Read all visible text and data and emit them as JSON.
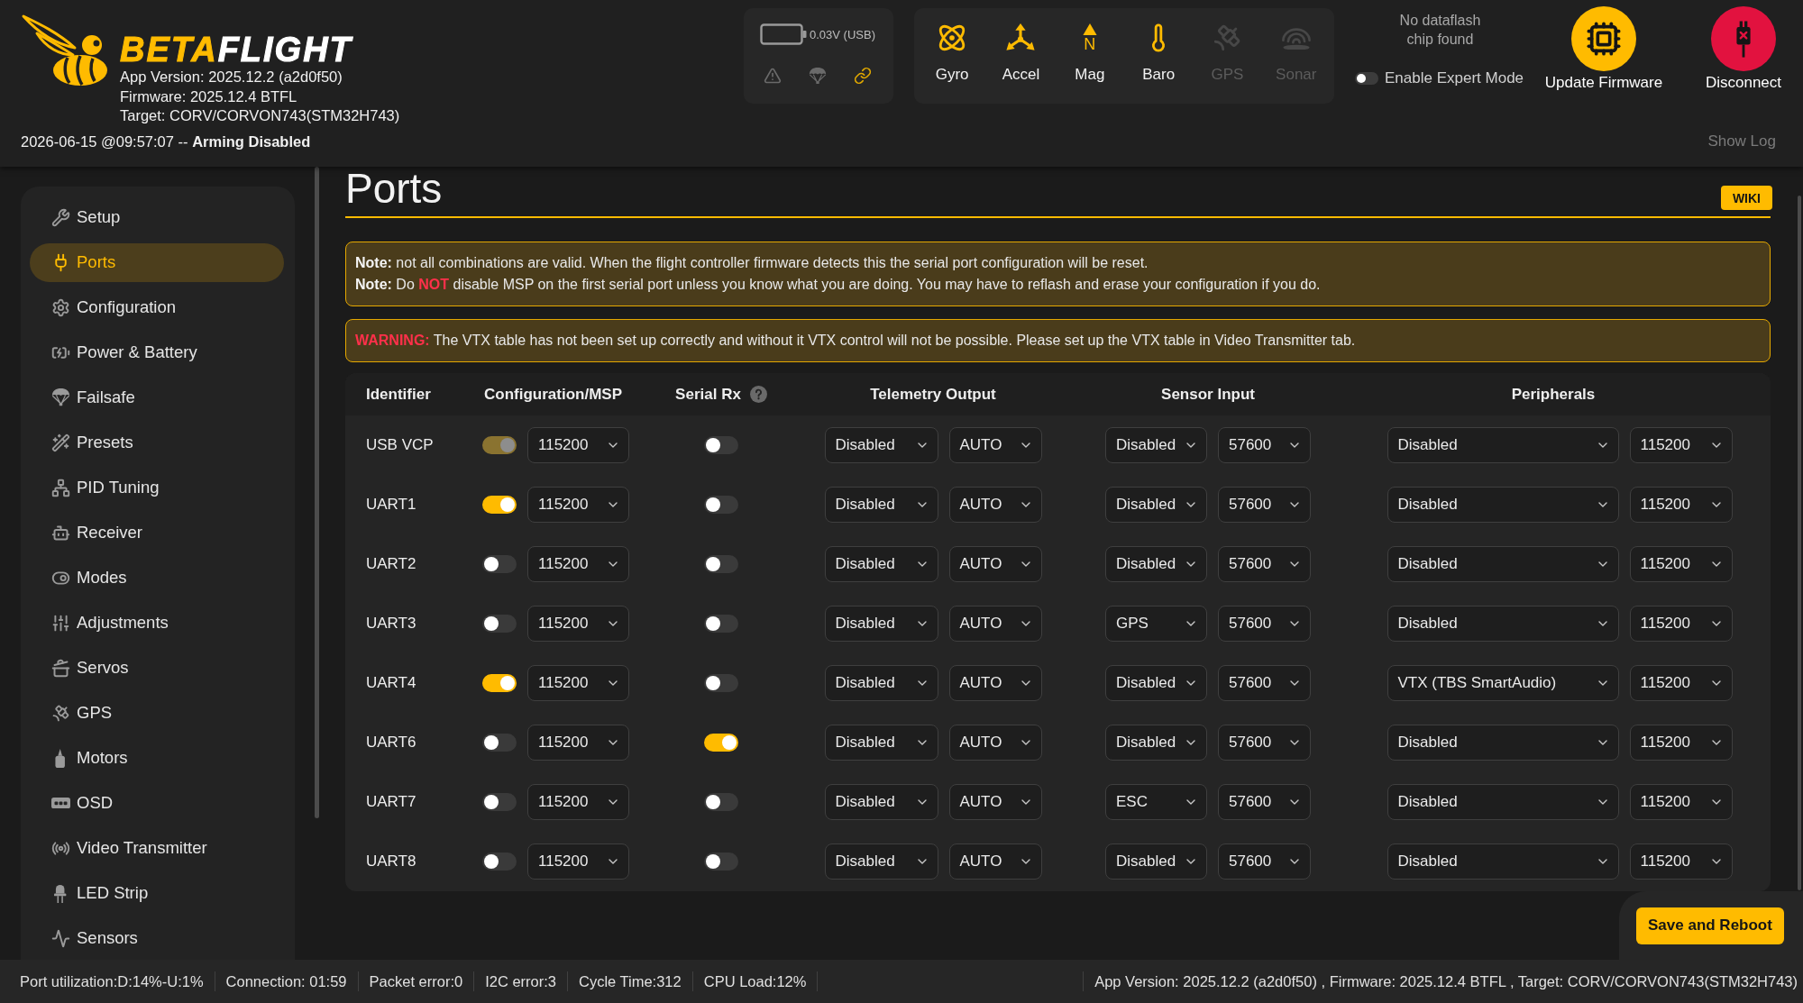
{
  "header": {
    "logo": {
      "accent": "BETA",
      "rest": "FLIGHT"
    },
    "version_lines": [
      "App Version: 2025.12.2 (a2d0f50)",
      "Firmware: 2025.12.4 BTFL",
      "Target: CORV/CORVON743(STM32H743)"
    ],
    "status_line": "2026-06-15 @09:57:07 -- **Arming Disabled**",
    "battery": {
      "reading": "0.03V (USB)"
    },
    "status_icons": [
      {
        "active": false
      },
      {
        "active": false
      },
      {
        "active": true
      }
    ],
    "sensors": [
      {
        "label": "Gyro",
        "active": true
      },
      {
        "label": "Accel",
        "active": true
      },
      {
        "label": "Mag",
        "active": true,
        "glyph": "N"
      },
      {
        "label": "Baro",
        "active": true
      },
      {
        "label": "GPS",
        "active": false
      },
      {
        "label": "Sonar",
        "active": false
      }
    ],
    "dataflash": "No dataflash chip found",
    "expert_mode": {
      "label": "Enable Expert Mode",
      "on": false
    },
    "actions": [
      {
        "kind": "update",
        "label": "Update Firmware"
      },
      {
        "kind": "disconnect",
        "label": "Disconnect"
      }
    ],
    "show_log": "Show Log"
  },
  "sidebar": {
    "items": [
      {
        "label": "Setup",
        "selected": false
      },
      {
        "label": "Ports",
        "selected": true
      },
      {
        "label": "Configuration",
        "selected": false
      },
      {
        "label": "Power & Battery",
        "selected": false
      },
      {
        "label": "Failsafe",
        "selected": false
      },
      {
        "label": "Presets",
        "selected": false
      },
      {
        "label": "PID Tuning",
        "selected": false
      },
      {
        "label": "Receiver",
        "selected": false
      },
      {
        "label": "Modes",
        "selected": false
      },
      {
        "label": "Adjustments",
        "selected": false
      },
      {
        "label": "Servos",
        "selected": false
      },
      {
        "label": "GPS",
        "selected": false
      },
      {
        "label": "Motors",
        "selected": false
      },
      {
        "label": "OSD",
        "selected": false
      },
      {
        "label": "Video Transmitter",
        "selected": false
      },
      {
        "label": "LED Strip",
        "selected": false
      },
      {
        "label": "Sensors",
        "selected": false
      }
    ]
  },
  "page": {
    "title": "Ports",
    "wiki_button": "WIKI",
    "notices": [
      {
        "kind": "note",
        "lines": [
          {
            "lead": "Note:",
            "text": "not all combinations are valid. When the flight controller firmware detects this the serial port configuration will be reset."
          },
          {
            "lead": "Note:",
            "text": "Do **NOT** disable MSP on the first serial port unless you know what you are doing. You may have to reflash and erase your configuration if you do."
          }
        ]
      },
      {
        "kind": "warning",
        "lines": [
          {
            "lead": "WARNING:",
            "text": "The VTX table has not been set up correctly and without it VTX control will not be possible. Please set up the VTX table in Video Transmitter tab."
          }
        ]
      }
    ],
    "table": {
      "columns": [
        {
          "label": "Identifier",
          "help": false
        },
        {
          "label": "Configuration/MSP",
          "help": false
        },
        {
          "label": "Serial Rx",
          "help": true
        },
        {
          "label": "Telemetry Output",
          "help": false
        },
        {
          "label": "Sensor Input",
          "help": false
        },
        {
          "label": "Peripherals",
          "help": false
        }
      ],
      "rows": [
        {
          "identifier": "USB VCP",
          "msp_on": true,
          "msp_disabled": true,
          "msp_baud": "115200",
          "serial_rx_on": false,
          "telemetry": {
            "protocol": "Disabled",
            "baud": "AUTO"
          },
          "sensor": {
            "protocol": "Disabled",
            "baud": "57600"
          },
          "peripherals": {
            "protocol": "Disabled",
            "baud": "115200"
          }
        },
        {
          "identifier": "UART1",
          "msp_on": true,
          "msp_disabled": false,
          "msp_baud": "115200",
          "serial_rx_on": false,
          "telemetry": {
            "protocol": "Disabled",
            "baud": "AUTO"
          },
          "sensor": {
            "protocol": "Disabled",
            "baud": "57600"
          },
          "peripherals": {
            "protocol": "Disabled",
            "baud": "115200"
          }
        },
        {
          "identifier": "UART2",
          "msp_on": false,
          "msp_disabled": false,
          "msp_baud": "115200",
          "serial_rx_on": false,
          "telemetry": {
            "protocol": "Disabled",
            "baud": "AUTO"
          },
          "sensor": {
            "protocol": "Disabled",
            "baud": "57600"
          },
          "peripherals": {
            "protocol": "Disabled",
            "baud": "115200"
          }
        },
        {
          "identifier": "UART3",
          "msp_on": false,
          "msp_disabled": false,
          "msp_baud": "115200",
          "serial_rx_on": false,
          "telemetry": {
            "protocol": "Disabled",
            "baud": "AUTO"
          },
          "sensor": {
            "protocol": "GPS",
            "baud": "57600"
          },
          "peripherals": {
            "protocol": "Disabled",
            "baud": "115200"
          }
        },
        {
          "identifier": "UART4",
          "msp_on": true,
          "msp_disabled": false,
          "msp_baud": "115200",
          "serial_rx_on": false,
          "telemetry": {
            "protocol": "Disabled",
            "baud": "AUTO"
          },
          "sensor": {
            "protocol": "Disabled",
            "baud": "57600"
          },
          "peripherals": {
            "protocol": "VTX (TBS SmartAudio)",
            "baud": "115200"
          }
        },
        {
          "identifier": "UART6",
          "msp_on": false,
          "msp_disabled": false,
          "msp_baud": "115200",
          "serial_rx_on": true,
          "telemetry": {
            "protocol": "Disabled",
            "baud": "AUTO"
          },
          "sensor": {
            "protocol": "Disabled",
            "baud": "57600"
          },
          "peripherals": {
            "protocol": "Disabled",
            "baud": "115200"
          }
        },
        {
          "identifier": "UART7",
          "msp_on": false,
          "msp_disabled": false,
          "msp_baud": "115200",
          "serial_rx_on": false,
          "telemetry": {
            "protocol": "Disabled",
            "baud": "AUTO"
          },
          "sensor": {
            "protocol": "ESC",
            "baud": "57600"
          },
          "peripherals": {
            "protocol": "Disabled",
            "baud": "115200"
          }
        },
        {
          "identifier": "UART8",
          "msp_on": false,
          "msp_disabled": false,
          "msp_baud": "115200",
          "serial_rx_on": false,
          "telemetry": {
            "protocol": "Disabled",
            "baud": "AUTO"
          },
          "sensor": {
            "protocol": "Disabled",
            "baud": "57600"
          },
          "peripherals": {
            "protocol": "Disabled",
            "baud": "115200"
          }
        }
      ]
    },
    "save_button": "Save and Reboot"
  },
  "status_bar": {
    "items": [
      "Port utilization:D:14%-U:1%",
      "Connection: 01:59",
      "Packet error:0",
      "I2C error:3",
      "Cycle Time:312",
      "CPU Load:12%"
    ],
    "version": "App Version: 2025.12.2 (a2d0f50) , Firmware: 2025.12.4 BTFL , Target: CORV/CORVON743(STM32H743)"
  }
}
